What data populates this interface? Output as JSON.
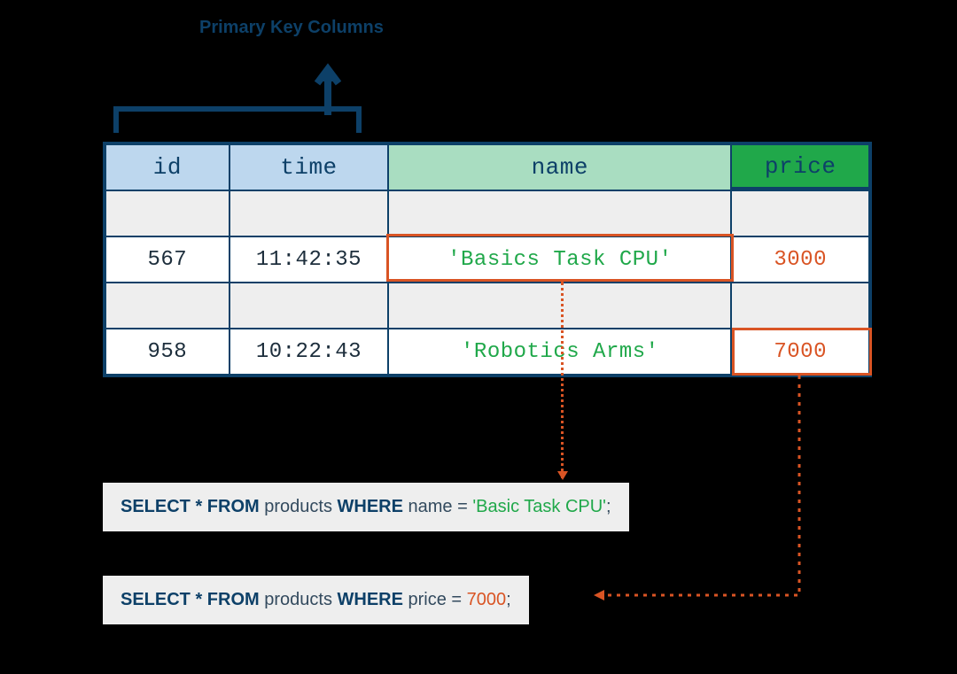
{
  "title": "Primary Key Columns",
  "headers": {
    "id": "id",
    "time": "time",
    "name": "name",
    "price": "price"
  },
  "rows": [
    {
      "id": "567",
      "time": "11:42:35",
      "name": "'Basics Task CPU'",
      "price": "3000"
    },
    {
      "id": "958",
      "time": "10:22:43",
      "name": "'Robotics Arms'",
      "price": "7000"
    }
  ],
  "sql": {
    "line1": {
      "kw1": "SELECT * FROM",
      "tbl": " products ",
      "kw2": "WHERE",
      "cond": " name = ",
      "lit": "'Basic Task CPU'",
      "end": ";"
    },
    "line2": {
      "kw1": "SELECT * FROM",
      "tbl": " products ",
      "kw2": "WHERE",
      "cond": " price = ",
      "lit": "7000",
      "end": ";"
    }
  },
  "chart_data": {
    "type": "table",
    "note": "Diagram illustrating primary key columns (id, time) and WHERE-clause filtering on non-key columns (name, price).",
    "columns": [
      "id",
      "time",
      "name",
      "price"
    ],
    "primary_key_columns": [
      "id",
      "time"
    ],
    "rows": [
      {
        "id": 567,
        "time": "11:42:35",
        "name": "Basics Task CPU",
        "price": 3000
      },
      {
        "id": 958,
        "time": "10:22:43",
        "name": "Robotics Arms",
        "price": 7000
      }
    ],
    "queries": [
      "SELECT * FROM products WHERE name = 'Basic Task CPU';",
      "SELECT * FROM products WHERE price = 7000;"
    ],
    "highlights": [
      {
        "row": 0,
        "column": "name"
      },
      {
        "row": 1,
        "column": "price"
      }
    ]
  }
}
